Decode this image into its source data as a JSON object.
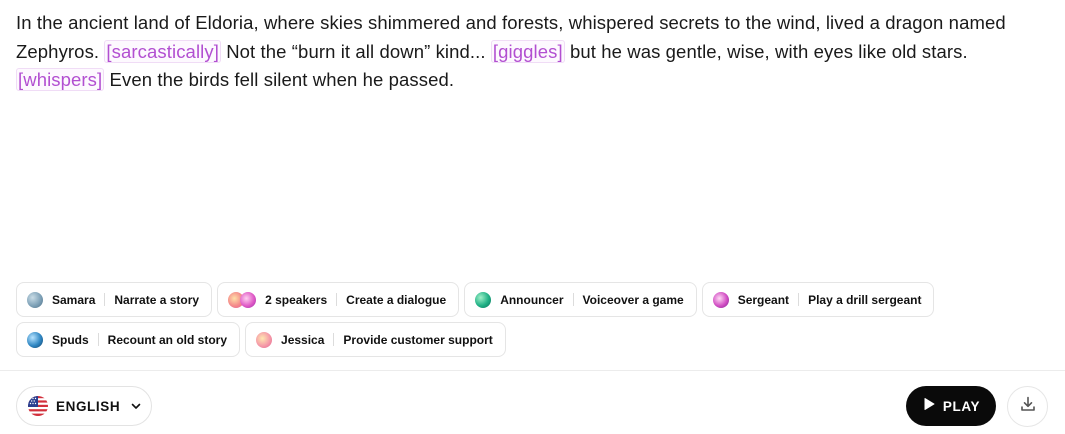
{
  "story": {
    "part1": "In the ancient land of Eldoria, where skies shimmered and forests, whispered secrets to the wind, lived a dragon named Zephyros.",
    "tag1": "[sarcastically]",
    "part2": "Not the “burn it all down” kind...",
    "tag2": "[giggles]",
    "part3": "but he was gentle, wise, with eyes like old stars.",
    "tag3": "[whispers]",
    "part4": "Even the birds fell silent when he passed."
  },
  "presets": {
    "row1": [
      {
        "voice": "Samara",
        "action": "Narrate a story",
        "avatar": "samara-avatar"
      },
      {
        "voice": "2 speakers",
        "action": "Create a dialogue",
        "avatar": "two-speakers-avatar"
      },
      {
        "voice": "Announcer",
        "action": "Voiceover a game",
        "avatar": "announcer-avatar"
      },
      {
        "voice": "Sergeant",
        "action": "Play a drill sergeant",
        "avatar": "sergeant-avatar"
      }
    ],
    "row2": [
      {
        "voice": "Spuds",
        "action": "Recount an old story",
        "avatar": "spuds-avatar"
      },
      {
        "voice": "Jessica",
        "action": "Provide customer support",
        "avatar": "jessica-avatar"
      }
    ]
  },
  "footer": {
    "language": "ENGLISH",
    "language_icon": "us-flag-icon",
    "play_label": "PLAY",
    "play_icon": "play-icon",
    "download_icon": "download-icon"
  },
  "colors": {
    "tag_text": "#b24fd1",
    "play_bg": "#0a0a0a",
    "border": "#e5e5e5"
  }
}
